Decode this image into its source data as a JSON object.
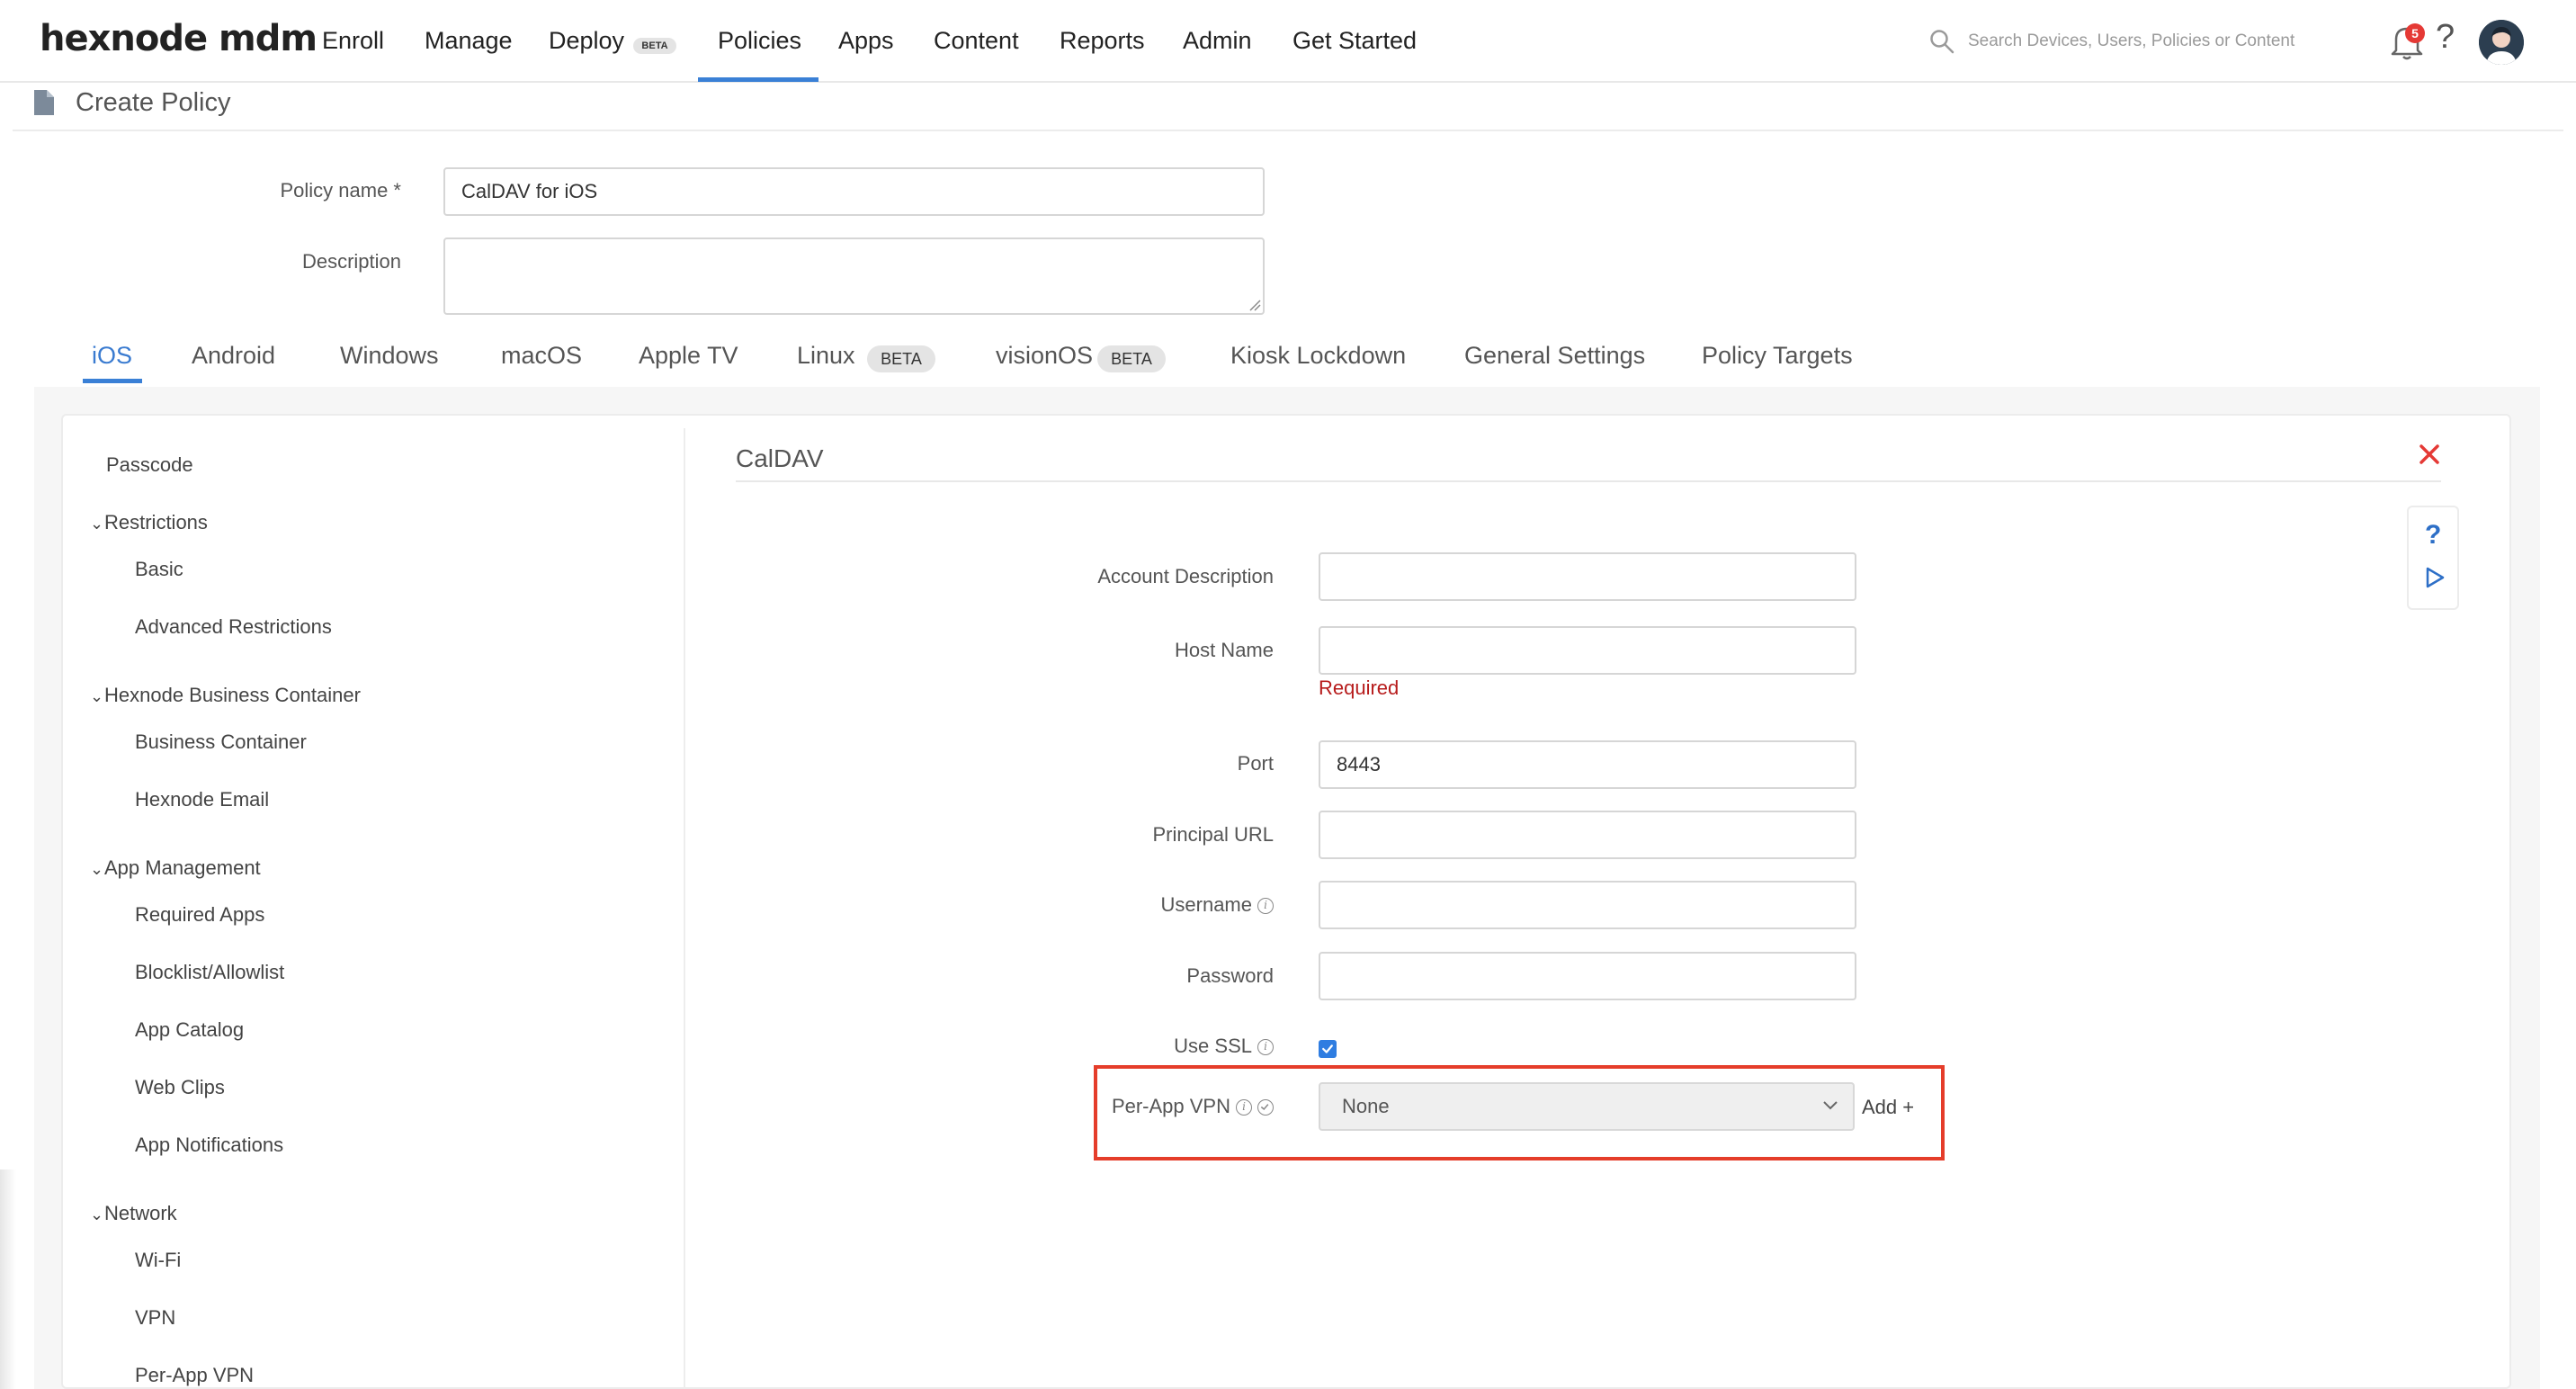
{
  "brand": {
    "logo_text": "hexnode mdm",
    "accent": "#3a80d6",
    "error": "#b71c1c",
    "highlight": "#e53d2a"
  },
  "nav": {
    "items": [
      "Enroll",
      "Manage",
      "Deploy",
      "Policies",
      "Apps",
      "Content",
      "Reports",
      "Admin",
      "Get Started"
    ],
    "active": "Policies",
    "deploy_badge": "BETA",
    "search_placeholder": "Search Devices, Users, Policies or Content",
    "notification_count": "5",
    "icons": [
      "search-icon",
      "bell-icon",
      "help-icon",
      "avatar"
    ]
  },
  "page": {
    "title": "Create Policy",
    "icon": "document-icon"
  },
  "policy_form": {
    "name_label": "Policy name *",
    "name_value": "CalDAV for iOS",
    "description_label": "Description",
    "description_value": ""
  },
  "platform_tabs": {
    "items": [
      "iOS",
      "Android",
      "Windows",
      "macOS",
      "Apple TV",
      "Linux",
      "visionOS",
      "Kiosk Lockdown",
      "General Settings",
      "Policy Targets"
    ],
    "active": "iOS",
    "linux_badge": "BETA",
    "visionos_badge": "BETA"
  },
  "sidebar": {
    "passcode": "Passcode",
    "groups": [
      {
        "label": "Restrictions",
        "items": [
          "Basic",
          "Advanced Restrictions"
        ]
      },
      {
        "label": "Hexnode Business Container",
        "items": [
          "Business Container",
          "Hexnode Email"
        ]
      },
      {
        "label": "App Management",
        "items": [
          "Required Apps",
          "Blocklist/Allowlist",
          "App Catalog",
          "Web Clips",
          "App Notifications"
        ]
      },
      {
        "label": "Network",
        "items": [
          "Wi-Fi",
          "VPN",
          "Per-App VPN"
        ]
      }
    ]
  },
  "caldav": {
    "title": "CalDAV",
    "account_description_label": "Account Description",
    "account_description_value": "",
    "host_name_label": "Host Name",
    "host_name_value": "",
    "host_name_error": "Required",
    "port_label": "Port",
    "port_value": "8443",
    "principal_url_label": "Principal URL",
    "principal_url_value": "",
    "username_label": "Username",
    "username_value": "",
    "password_label": "Password",
    "password_value": "",
    "use_ssl_label": "Use SSL",
    "use_ssl_checked": true,
    "per_app_vpn_label": "Per-App VPN",
    "per_app_vpn_selected": "None",
    "add_label": "Add +"
  }
}
